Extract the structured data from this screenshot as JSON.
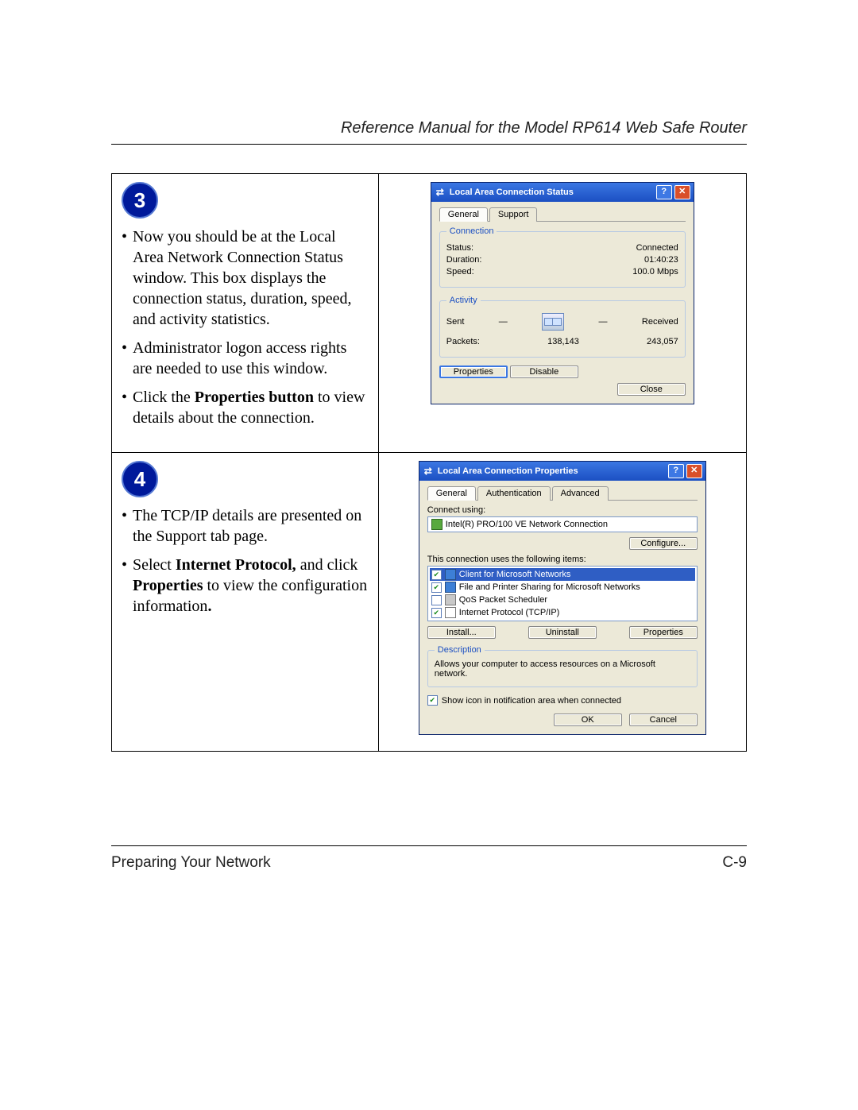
{
  "header": "Reference Manual for the Model RP614 Web Safe Router",
  "footer_left": "Preparing Your Network",
  "footer_right": "C-9",
  "step3": {
    "num": "3",
    "b1": "Now you should be at the Local Area Network Connection Status window. This box displays the connection status, duration, speed, and activity statistics.",
    "b2": "Administrator logon access rights are needed to use this window.",
    "b3a": "Click the ",
    "b3b": "Properties button",
    "b3c": " to view details about the connection."
  },
  "step4": {
    "num": "4",
    "b1": "The TCP/IP details are presented on the Support tab page.",
    "b2a": "Select ",
    "b2b": "Internet Protocol,",
    "b2c": " and click ",
    "b2d": "Properties",
    "b2e": " to view the configuration information",
    "b2f": "."
  },
  "dlg_status": {
    "title": "Local Area Connection Status",
    "tab_general": "General",
    "tab_support": "Support",
    "grp_conn": "Connection",
    "lbl_status": "Status:",
    "val_status": "Connected",
    "lbl_duration": "Duration:",
    "val_duration": "01:40:23",
    "lbl_speed": "Speed:",
    "val_speed": "100.0 Mbps",
    "grp_act": "Activity",
    "lbl_sent": "Sent",
    "lbl_recv": "Received",
    "lbl_packets": "Packets:",
    "val_sent": "138,143",
    "val_recv": "243,057",
    "btn_props": "Properties",
    "btn_disable": "Disable",
    "btn_close": "Close"
  },
  "dlg_props": {
    "title": "Local Area Connection Properties",
    "tab_general": "General",
    "tab_auth": "Authentication",
    "tab_adv": "Advanced",
    "lbl_connect_using": "Connect using:",
    "adapter": "Intel(R) PRO/100 VE Network Connection",
    "btn_configure": "Configure...",
    "lbl_items": "This connection uses the following items:",
    "item1": "Client for Microsoft Networks",
    "item2": "File and Printer Sharing for Microsoft Networks",
    "item3": "QoS Packet Scheduler",
    "item4": "Internet Protocol (TCP/IP)",
    "btn_install": "Install...",
    "btn_uninstall": "Uninstall",
    "btn_props": "Properties",
    "grp_desc": "Description",
    "desc_text": "Allows your computer to access resources on a Microsoft network.",
    "chk_notify": "Show icon in notification area when connected",
    "btn_ok": "OK",
    "btn_cancel": "Cancel"
  }
}
